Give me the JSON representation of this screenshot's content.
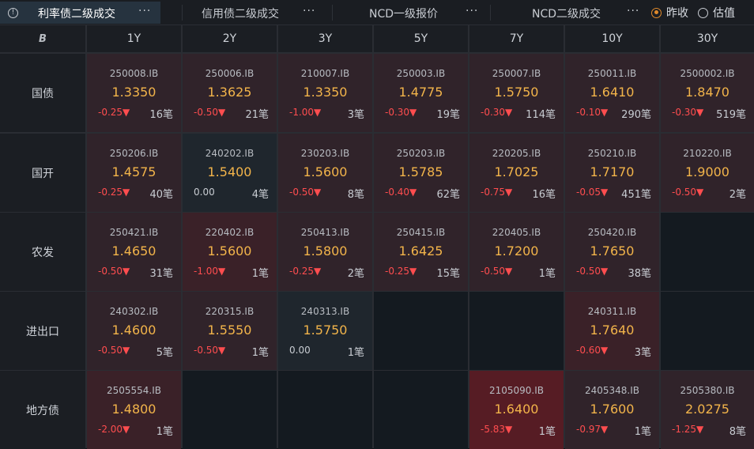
{
  "tabs": [
    {
      "label": "利率债二级成交",
      "more": "···",
      "active": true
    },
    {
      "label": "信用债二级成交",
      "more": "···",
      "active": false
    },
    {
      "label": "NCD一级报价",
      "more": "···",
      "active": false
    },
    {
      "label": "NCD二级成交",
      "more": "···",
      "active": false
    }
  ],
  "radios": [
    {
      "label": "昨收",
      "selected": true
    },
    {
      "label": "估值",
      "selected": false
    }
  ],
  "corner_icon": "B",
  "columns": [
    "1Y",
    "2Y",
    "3Y",
    "5Y",
    "7Y",
    "10Y",
    "30Y"
  ],
  "rows": [
    {
      "label": "国债",
      "cells": [
        {
          "code": "250008.IB",
          "yield": "1.3350",
          "change": "-0.25▼",
          "count": "16笔",
          "tone": "t0"
        },
        {
          "code": "250006.IB",
          "yield": "1.3625",
          "change": "-0.50▼",
          "count": "21笔",
          "tone": "t0"
        },
        {
          "code": "210007.IB",
          "yield": "1.3350",
          "change": "-1.00▼",
          "count": "3笔",
          "tone": "t0"
        },
        {
          "code": "250003.IB",
          "yield": "1.4775",
          "change": "-0.30▼",
          "count": "19笔",
          "tone": "t0"
        },
        {
          "code": "250007.IB",
          "yield": "1.5750",
          "change": "-0.30▼",
          "count": "114笔",
          "tone": "t0"
        },
        {
          "code": "250011.IB",
          "yield": "1.6410",
          "change": "-0.10▼",
          "count": "290笔",
          "tone": "t0"
        },
        {
          "code": "2500002.IB",
          "yield": "1.8470",
          "change": "-0.30▼",
          "count": "519笔",
          "tone": "t0"
        }
      ]
    },
    {
      "label": "国开",
      "cells": [
        {
          "code": "250206.IB",
          "yield": "1.4575",
          "change": "-0.25▼",
          "count": "40笔",
          "tone": "t0"
        },
        {
          "code": "240202.IB",
          "yield": "1.5400",
          "change": "0.00",
          "count": "4笔",
          "tone": "neutral"
        },
        {
          "code": "230203.IB",
          "yield": "1.5600",
          "change": "-0.50▼",
          "count": "8笔",
          "tone": "t0"
        },
        {
          "code": "250203.IB",
          "yield": "1.5785",
          "change": "-0.40▼",
          "count": "62笔",
          "tone": "t0"
        },
        {
          "code": "220205.IB",
          "yield": "1.7025",
          "change": "-0.75▼",
          "count": "16笔",
          "tone": "t0"
        },
        {
          "code": "250210.IB",
          "yield": "1.7170",
          "change": "-0.05▼",
          "count": "451笔",
          "tone": "t0"
        },
        {
          "code": "210220.IB",
          "yield": "1.9000",
          "change": "-0.50▼",
          "count": "2笔",
          "tone": "t0"
        }
      ]
    },
    {
      "label": "农发",
      "cells": [
        {
          "code": "250421.IB",
          "yield": "1.4650",
          "change": "-0.50▼",
          "count": "31笔",
          "tone": "t0"
        },
        {
          "code": "220402.IB",
          "yield": "1.5600",
          "change": "-1.00▼",
          "count": "1笔",
          "tone": "t1"
        },
        {
          "code": "250413.IB",
          "yield": "1.5800",
          "change": "-0.25▼",
          "count": "2笔",
          "tone": "t0"
        },
        {
          "code": "250415.IB",
          "yield": "1.6425",
          "change": "-0.25▼",
          "count": "15笔",
          "tone": "t0"
        },
        {
          "code": "220405.IB",
          "yield": "1.7200",
          "change": "-0.50▼",
          "count": "1笔",
          "tone": "t0"
        },
        {
          "code": "250420.IB",
          "yield": "1.7650",
          "change": "-0.50▼",
          "count": "38笔",
          "tone": "t0"
        },
        null
      ]
    },
    {
      "label": "进出口",
      "cells": [
        {
          "code": "240302.IB",
          "yield": "1.4600",
          "change": "-0.50▼",
          "count": "5笔",
          "tone": "t0"
        },
        {
          "code": "220315.IB",
          "yield": "1.5550",
          "change": "-0.50▼",
          "count": "1笔",
          "tone": "t0"
        },
        {
          "code": "240313.IB",
          "yield": "1.5750",
          "change": "0.00",
          "count": "1笔",
          "tone": "neutral"
        },
        null,
        null,
        {
          "code": "240311.IB",
          "yield": "1.7640",
          "change": "-0.60▼",
          "count": "3笔",
          "tone": "t1"
        },
        null
      ]
    },
    {
      "label": "地方债",
      "cells": [
        {
          "code": "2505554.IB",
          "yield": "1.4800",
          "change": "-2.00▼",
          "count": "1笔",
          "tone": "t1"
        },
        null,
        null,
        null,
        {
          "code": "2105090.IB",
          "yield": "1.6400",
          "change": "-5.83▼",
          "count": "1笔",
          "tone": "t2"
        },
        {
          "code": "2405348.IB",
          "yield": "1.7600",
          "change": "-0.97▼",
          "count": "1笔",
          "tone": "t0"
        },
        {
          "code": "2505380.IB",
          "yield": "2.0275",
          "change": "-1.25▼",
          "count": "8笔",
          "tone": "t0"
        }
      ]
    }
  ]
}
